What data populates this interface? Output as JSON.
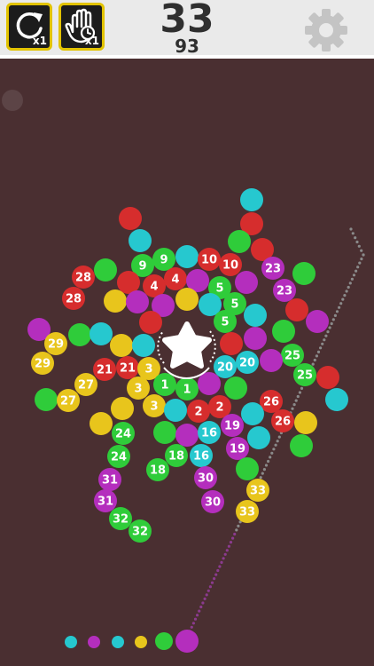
{
  "hud": {
    "undo_count": "x1",
    "timer_count": "x1",
    "score": "33",
    "best": "93"
  },
  "colors": {
    "red": "#d62d2d",
    "green": "#2fcc3a",
    "cyan": "#26c8cf",
    "yellow": "#e8c51c",
    "purple": "#b42ebd",
    "background": "#4a2f31",
    "frame": "#e2c300"
  },
  "board": {
    "balls": [
      {
        "color": "cyan"
      },
      {
        "color": "red"
      },
      {
        "color": "red"
      },
      {
        "color": "cyan"
      },
      {
        "color": "green"
      },
      {
        "color": "red"
      },
      {
        "color": "green",
        "label": "9"
      },
      {
        "color": "green",
        "label": "9"
      },
      {
        "color": "cyan"
      },
      {
        "color": "red",
        "label": "10"
      },
      {
        "color": "red",
        "label": "10"
      },
      {
        "color": "purple",
        "label": "23"
      },
      {
        "color": "green"
      },
      {
        "color": "red",
        "label": "28"
      },
      {
        "color": "green"
      },
      {
        "color": "red"
      },
      {
        "color": "red",
        "label": "4"
      },
      {
        "color": "red",
        "label": "4"
      },
      {
        "color": "purple"
      },
      {
        "color": "green",
        "label": "5"
      },
      {
        "color": "purple"
      },
      {
        "color": "purple",
        "label": "23"
      },
      {
        "color": "red",
        "label": "28"
      },
      {
        "color": "yellow"
      },
      {
        "color": "purple"
      },
      {
        "color": "purple"
      },
      {
        "color": "yellow"
      },
      {
        "color": "cyan"
      },
      {
        "color": "green",
        "label": "5"
      },
      {
        "color": "red"
      },
      {
        "color": "cyan"
      },
      {
        "color": "red"
      },
      {
        "color": "purple"
      },
      {
        "color": "purple"
      },
      {
        "color": "green",
        "label": "5"
      },
      {
        "color": "green"
      },
      {
        "color": "green"
      },
      {
        "color": "cyan"
      },
      {
        "color": "yellow",
        "label": "29"
      },
      {
        "color": "yellow"
      },
      {
        "color": "cyan"
      },
      {
        "color": "red"
      },
      {
        "color": "purple"
      },
      {
        "color": "green",
        "label": "25"
      },
      {
        "color": "yellow",
        "label": "29"
      },
      {
        "color": "red",
        "label": "21"
      },
      {
        "color": "red",
        "label": "21"
      },
      {
        "color": "yellow",
        "label": "3"
      },
      {
        "color": "cyan",
        "label": "20"
      },
      {
        "color": "cyan",
        "label": "20"
      },
      {
        "color": "purple"
      },
      {
        "color": "green",
        "label": "25"
      },
      {
        "color": "red"
      },
      {
        "color": "yellow",
        "label": "27"
      },
      {
        "color": "yellow",
        "label": "3"
      },
      {
        "color": "green",
        "label": "1"
      },
      {
        "color": "green",
        "label": "1"
      },
      {
        "color": "purple"
      },
      {
        "color": "green"
      },
      {
        "color": "green"
      },
      {
        "color": "yellow",
        "label": "27"
      },
      {
        "color": "red",
        "label": "26"
      },
      {
        "color": "cyan"
      },
      {
        "color": "yellow"
      },
      {
        "color": "yellow",
        "label": "3"
      },
      {
        "color": "cyan"
      },
      {
        "color": "red",
        "label": "2"
      },
      {
        "color": "red",
        "label": "2"
      },
      {
        "color": "cyan"
      },
      {
        "color": "red",
        "label": "26"
      },
      {
        "color": "yellow"
      },
      {
        "color": "yellow"
      },
      {
        "color": "purple",
        "label": "19"
      },
      {
        "color": "green",
        "label": "24"
      },
      {
        "color": "green"
      },
      {
        "color": "purple"
      },
      {
        "color": "cyan",
        "label": "16"
      },
      {
        "color": "cyan"
      },
      {
        "color": "purple",
        "label": "19"
      },
      {
        "color": "green"
      },
      {
        "color": "green",
        "label": "24"
      },
      {
        "color": "green",
        "label": "18"
      },
      {
        "color": "cyan",
        "label": "16"
      },
      {
        "color": "green",
        "label": "18"
      },
      {
        "color": "green"
      },
      {
        "color": "purple",
        "label": "31"
      },
      {
        "color": "purple",
        "label": "30"
      },
      {
        "color": "yellow",
        "label": "33"
      },
      {
        "color": "purple",
        "label": "31"
      },
      {
        "color": "purple",
        "label": "30"
      },
      {
        "color": "yellow",
        "label": "33"
      },
      {
        "color": "green",
        "label": "32"
      },
      {
        "color": "green",
        "label": "32"
      }
    ]
  },
  "queue": {
    "balls": [
      {
        "color": "cyan"
      },
      {
        "color": "purple"
      },
      {
        "color": "cyan"
      },
      {
        "color": "yellow"
      },
      {
        "color": "green"
      },
      {
        "color": "purple"
      }
    ]
  }
}
